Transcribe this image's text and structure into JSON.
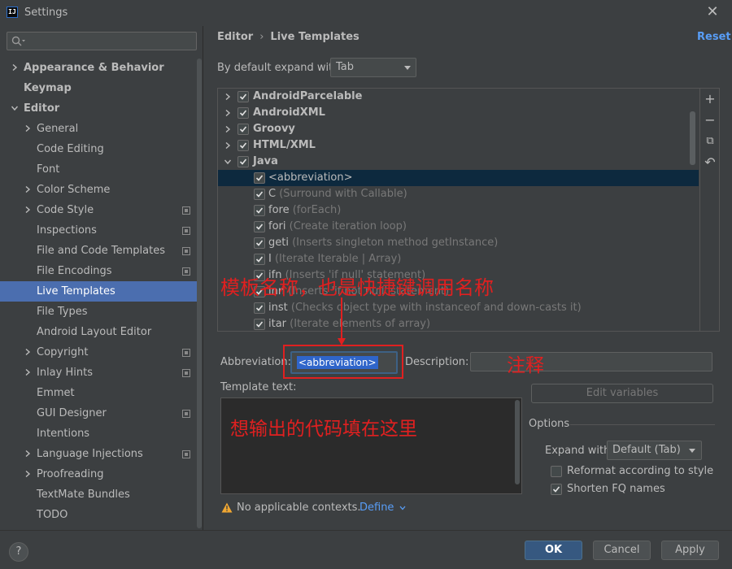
{
  "window": {
    "title": "Settings",
    "close_glyph": "✕",
    "app_icon_letters": "IJ"
  },
  "sidebar": {
    "search": {
      "placeholder": ""
    },
    "items": [
      {
        "label": "Appearance & Behavior",
        "bold": true,
        "expandable": true,
        "expanded": false
      },
      {
        "label": "Keymap",
        "bold": true
      },
      {
        "label": "Editor",
        "bold": true,
        "expandable": true,
        "expanded": true
      },
      {
        "label": "General",
        "expandable": true
      },
      {
        "label": "Code Editing"
      },
      {
        "label": "Font"
      },
      {
        "label": "Color Scheme",
        "expandable": true
      },
      {
        "label": "Code Style",
        "expandable": true,
        "project_icon": true
      },
      {
        "label": "Inspections",
        "project_icon": true
      },
      {
        "label": "File and Code Templates",
        "project_icon": true
      },
      {
        "label": "File Encodings",
        "project_icon": true
      },
      {
        "label": "Live Templates",
        "selected": true
      },
      {
        "label": "File Types"
      },
      {
        "label": "Android Layout Editor"
      },
      {
        "label": "Copyright",
        "expandable": true,
        "project_icon": true
      },
      {
        "label": "Inlay Hints",
        "expandable": true,
        "project_icon": true
      },
      {
        "label": "Emmet"
      },
      {
        "label": "GUI Designer",
        "project_icon": true
      },
      {
        "label": "Intentions"
      },
      {
        "label": "Language Injections",
        "expandable": true,
        "project_icon": true
      },
      {
        "label": "Proofreading",
        "expandable": true
      },
      {
        "label": "TextMate Bundles"
      },
      {
        "label": "TODO"
      }
    ]
  },
  "breadcrumb": {
    "parent": "Editor",
    "separator": "›",
    "current": "Live Templates"
  },
  "reset_label": "Reset",
  "expand_with": {
    "label": "By default expand with",
    "value": "Tab"
  },
  "template_tree": [
    {
      "abbr": "AndroidParcelable",
      "group": true,
      "checked": true
    },
    {
      "abbr": "AndroidXML",
      "group": true,
      "checked": true
    },
    {
      "abbr": "Groovy",
      "group": true,
      "checked": true
    },
    {
      "abbr": "HTML/XML",
      "group": true,
      "checked": true
    },
    {
      "abbr": "Java",
      "group": true,
      "checked": true,
      "expanded": true
    },
    {
      "abbr": "<abbreviation>",
      "desc": "",
      "checked": true,
      "selected": true
    },
    {
      "abbr": "C",
      "desc": "(Surround with Callable)",
      "checked": true
    },
    {
      "abbr": "fore",
      "desc": "(forEach)",
      "checked": true
    },
    {
      "abbr": "fori",
      "desc": "(Create iteration loop)",
      "checked": true
    },
    {
      "abbr": "geti",
      "desc": "(Inserts singleton method getInstance)",
      "checked": true
    },
    {
      "abbr": "I",
      "desc": "(Iterate Iterable | Array)",
      "checked": true
    },
    {
      "abbr": "ifn",
      "desc": "(Inserts 'if null' statement)",
      "checked": true
    },
    {
      "abbr": "inn",
      "desc": "(Inserts 'if not null' statement)",
      "checked": true
    },
    {
      "abbr": "inst",
      "desc": "(Checks object type with instanceof and down-casts it)",
      "checked": true
    },
    {
      "abbr": "itar",
      "desc": "(Iterate elements of array)",
      "checked": true
    }
  ],
  "tree_toolbar": {
    "add": "+",
    "remove": "−",
    "copy": "⧉",
    "restore": "↶"
  },
  "editor": {
    "abbreviation_label": "Abbreviation:",
    "abbreviation_value": "<abbreviation>",
    "description_label": "Description:",
    "description_value": "",
    "template_text_label": "Template text:",
    "template_text_value": ""
  },
  "annotations": {
    "name_note": "模板名称，也是快捷键调用名称",
    "comment_note": "注释",
    "code_note": "想输出的代码填在这里"
  },
  "edit_variables_label": "Edit variables",
  "options": {
    "title": "Options",
    "expand_with_label": "Expand with",
    "expand_with_value": "Default (Tab)",
    "reformat_label": "Reformat according to style",
    "reformat_checked": false,
    "shorten_label": "Shorten FQ names",
    "shorten_checked": true
  },
  "context": {
    "warning_text": "No applicable contexts.",
    "define_label": "Define"
  },
  "footer": {
    "help": "?",
    "ok": "OK",
    "cancel": "Cancel",
    "apply": "Apply"
  },
  "colors": {
    "accent": "#4b6eaf",
    "link": "#589df6",
    "annotation": "#e02020",
    "background": "#3c3f41"
  }
}
